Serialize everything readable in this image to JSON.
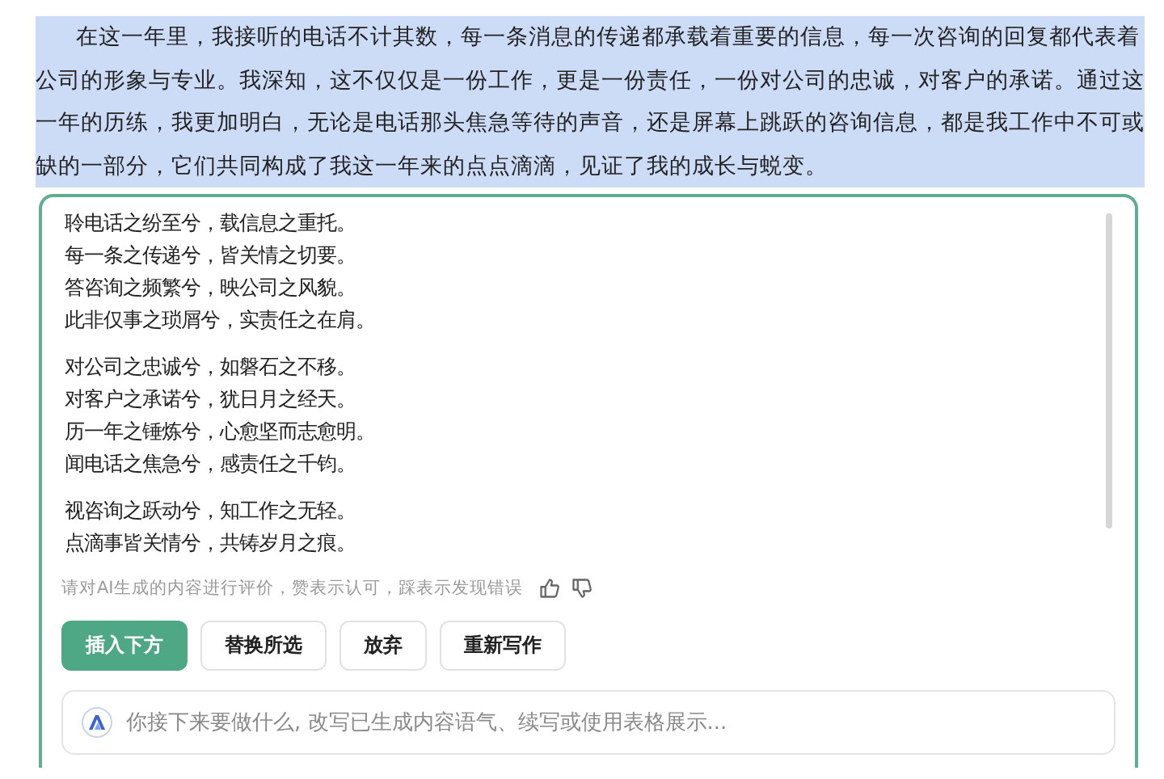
{
  "selected_paragraph": "在这一年里，我接听的电话不计其数，每一条消息的传递都承载着重要的信息，每一次咨询的回复都代表着公司的形象与专业。我深知，这不仅仅是一份工作，更是一份责任，一份对公司的忠诚，对客户的承诺。通过这一年的历练，我更加明白，无论是电话那头焦急等待的声音，还是屏幕上跳跃的咨询信息，都是我工作中不可或缺的一部分，它们共同构成了我这一年来的点点滴滴，见证了我的成长与蜕变。",
  "ai_panel": {
    "stanzas": [
      [
        "聆电话之纷至兮，载信息之重托。",
        "每一条之传递兮，皆关情之切要。",
        "答咨询之频繁兮，映公司之风貌。",
        "此非仅事之琐屑兮，实责任之在肩。"
      ],
      [
        "对公司之忠诚兮，如磐石之不移。",
        "对客户之承诺兮，犹日月之经天。",
        "历一年之锤炼兮，心愈坚而志愈明。",
        "闻电话之焦急兮，感责任之千钧。"
      ],
      [
        "视咨询之跃动兮，知工作之无轻。",
        "点滴事皆关情兮，共铸岁月之痕。"
      ]
    ],
    "feedback_hint": "请对AI生成的内容进行评价，赞表示认可，踩表示发现错误",
    "buttons": [
      {
        "label": "插入下方",
        "kind": "primary"
      },
      {
        "label": "替换所选",
        "kind": "secondary"
      },
      {
        "label": "放弃",
        "kind": "secondary"
      },
      {
        "label": "重新写作",
        "kind": "secondary"
      }
    ],
    "prompt_input": {
      "placeholder": "你接下来要做什么, 改写已生成内容语气、续写或使用表格展示..."
    }
  }
}
